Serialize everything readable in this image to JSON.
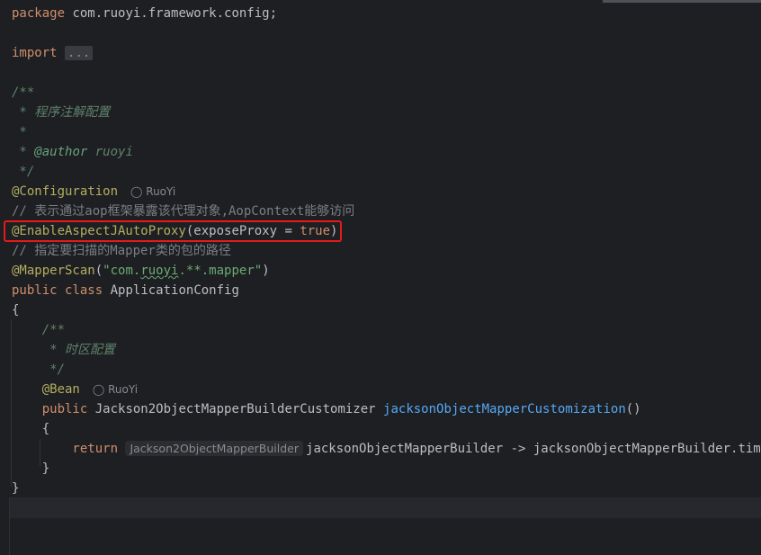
{
  "editor": {
    "package_kw": "package",
    "package_name": " com.ruoyi.framework.config;",
    "import_kw": "import",
    "import_fold": "...",
    "doc_open": "/**",
    "doc_desc": " * 程序注解配置",
    "doc_star": " *",
    "doc_author_prefix": " * ",
    "doc_author_tag": "@author",
    "doc_author_name": " ruoyi",
    "doc_close": " */",
    "configuration_ann": "@Configuration",
    "author_hint_1": "RuoYi",
    "comment_aop": "// 表示通过aop框架暴露该代理对象,AopContext能够访问",
    "enable_ann": "@EnableAspectJAutoProxy",
    "enable_args_open": "(exposeProxy = ",
    "enable_true": "true",
    "enable_args_close": ")",
    "comment_mapper": "// 指定要扫描的Mapper类的包的路径",
    "mapperscan_ann": "@MapperScan",
    "mapperscan_paren_open": "(",
    "mapperscan_str_a": "\"com.",
    "mapperscan_str_b": "ruoyi",
    "mapperscan_str_c": ".**.mapper\"",
    "mapperscan_paren_close": ")",
    "class_public": "public",
    "class_kw": "class",
    "class_name": " ApplicationConfig",
    "brace_open": "{",
    "inner_doc_open": "    /**",
    "inner_doc_desc": "     * 时区配置",
    "inner_doc_close": "     */",
    "bean_ann": "    @Bean",
    "author_hint_2": "RuoYi",
    "method_public": "    public",
    "method_type": " Jackson2ObjectMapperBuilderCustomizer ",
    "method_name": "jacksonObjectMapperCustomization",
    "method_parens": "()",
    "method_brace_open": "    {",
    "return_kw": "        return",
    "param_hint": "Jackson2ObjectMapperBuilder",
    "return_rest": "jacksonObjectMapperBuilder -> jacksonObjectMapperBuilder.timeZon",
    "method_brace_close": "    }",
    "brace_close": "}"
  },
  "colors": {
    "background": "#1e1f22",
    "keyword": "#cf8e6d",
    "annotation": "#b3ae60",
    "string": "#6aab73",
    "comment": "#7a7e85",
    "doc_comment": "#5f826b",
    "method": "#56a8f5",
    "highlight_box": "#e51a1a"
  }
}
